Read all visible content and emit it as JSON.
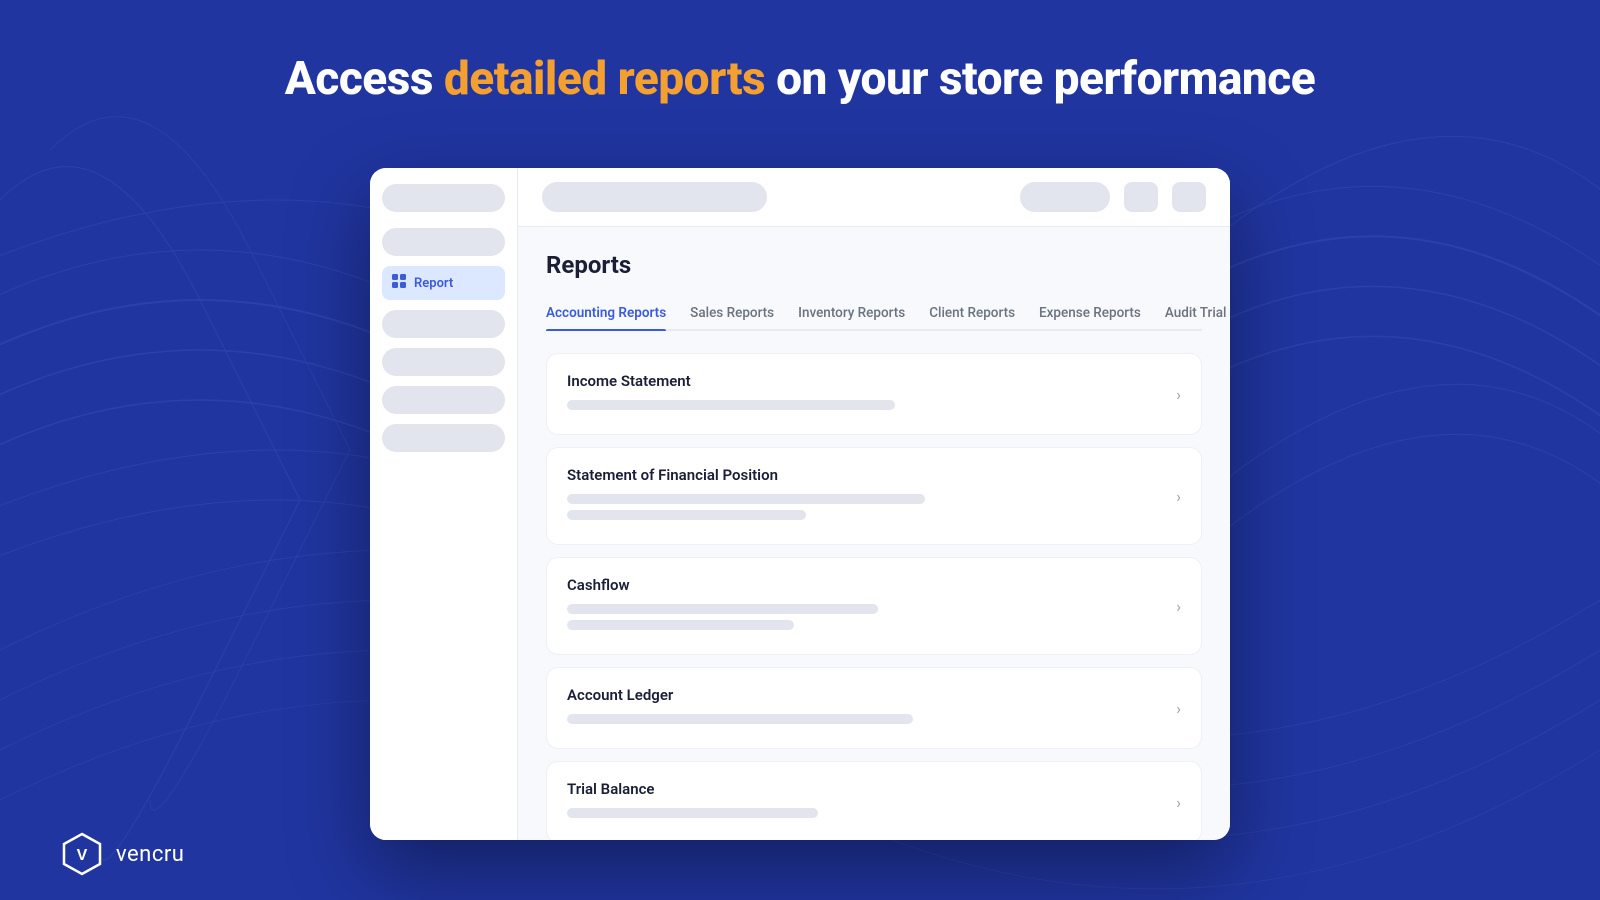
{
  "hero": {
    "prefix": "Access ",
    "highlight": "detailed reports",
    "suffix": " on your store performance"
  },
  "sidebar": {
    "report_label": "Report",
    "items": [
      {
        "id": "top1",
        "active": false
      },
      {
        "id": "top2",
        "active": false
      },
      {
        "id": "s1",
        "active": false
      },
      {
        "id": "s2",
        "active": false
      },
      {
        "id": "s3",
        "active": false
      },
      {
        "id": "s4",
        "active": false
      },
      {
        "id": "s5",
        "active": false
      }
    ]
  },
  "topbar": {
    "search_placeholder": "",
    "button_label": "",
    "icon1": "",
    "icon2": ""
  },
  "reports": {
    "title": "Reports",
    "tabs": [
      {
        "id": "accounting",
        "label": "Accounting Reports",
        "active": true
      },
      {
        "id": "sales",
        "label": "Sales Reports",
        "active": false
      },
      {
        "id": "inventory",
        "label": "Inventory Reports",
        "active": false
      },
      {
        "id": "client",
        "label": "Client Reports",
        "active": false
      },
      {
        "id": "expense",
        "label": "Expense Reports",
        "active": false
      },
      {
        "id": "audit",
        "label": "Audit Trial",
        "active": false
      }
    ],
    "items": [
      {
        "id": "income",
        "title": "Income Statement",
        "skeleton_lines": [
          {
            "width": "55%"
          }
        ]
      },
      {
        "id": "financial",
        "title": "Statement of Financial Position",
        "skeleton_lines": [
          {
            "width": "60%"
          },
          {
            "width": "40%"
          }
        ]
      },
      {
        "id": "cashflow",
        "title": "Cashflow",
        "skeleton_lines": [
          {
            "width": "52%"
          },
          {
            "width": "38%"
          }
        ]
      },
      {
        "id": "ledger",
        "title": "Account Ledger",
        "skeleton_lines": [
          {
            "width": "58%"
          }
        ]
      },
      {
        "id": "trial",
        "title": "Trial Balance",
        "skeleton_lines": [
          {
            "width": "42%"
          }
        ]
      }
    ]
  },
  "brand": {
    "name": "vencru"
  },
  "colors": {
    "accent": "#3b5bdb",
    "highlight": "#f4a030",
    "bg": "#2035a0",
    "white": "#ffffff"
  }
}
